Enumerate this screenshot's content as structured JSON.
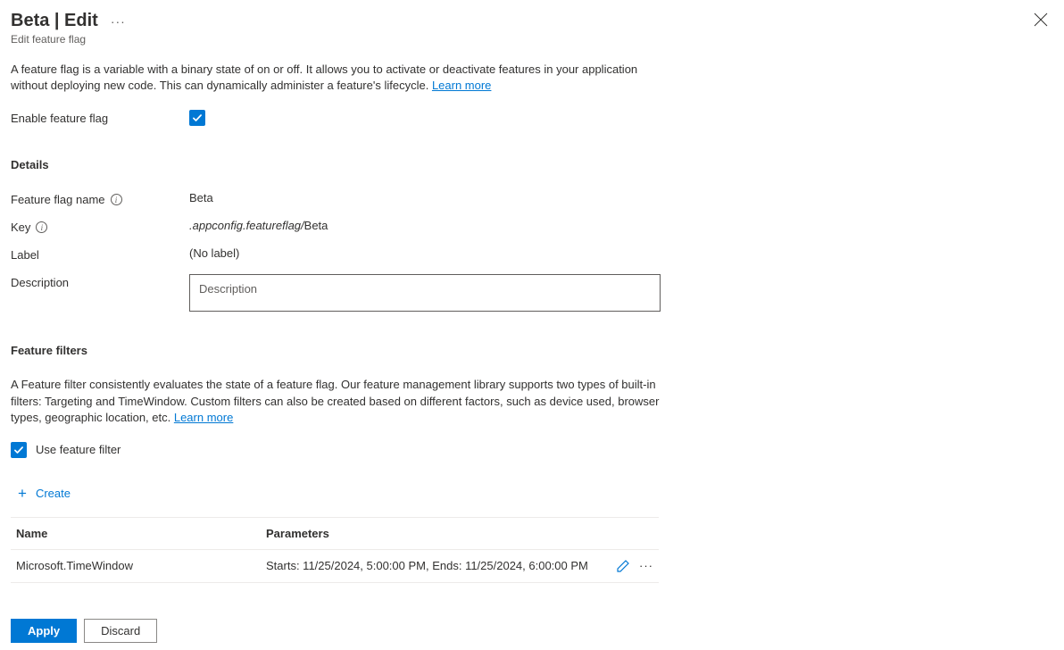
{
  "header": {
    "title": "Beta | Edit",
    "subtitle": "Edit feature flag"
  },
  "intro": {
    "text": "A feature flag is a variable with a binary state of on or off. It allows you to activate or deactivate features in your application without deploying new code. This can dynamically administer a feature's lifecycle. ",
    "learn_more": "Learn more"
  },
  "enable": {
    "label": "Enable feature flag"
  },
  "details": {
    "heading": "Details",
    "name_label": "Feature flag name",
    "name_value": "Beta",
    "key_label": "Key",
    "key_prefix": ".appconfig.featureflag/",
    "key_suffix": "Beta",
    "label_label": "Label",
    "label_value": "(No label)",
    "description_label": "Description",
    "description_placeholder": "Description"
  },
  "filters": {
    "heading": "Feature filters",
    "intro": "A Feature filter consistently evaluates the state of a feature flag. Our feature management library supports two types of built-in filters: Targeting and TimeWindow. Custom filters can also be created based on different factors, such as device used, browser types, geographic location, etc. ",
    "learn_more": "Learn more",
    "use_filter_label": "Use feature filter",
    "create_label": "Create",
    "col_name": "Name",
    "col_params": "Parameters",
    "rows": [
      {
        "name": "Microsoft.TimeWindow",
        "params": "Starts: 11/25/2024, 5:00:00 PM, Ends: 11/25/2024, 6:00:00 PM"
      }
    ]
  },
  "footer": {
    "apply": "Apply",
    "discard": "Discard"
  }
}
